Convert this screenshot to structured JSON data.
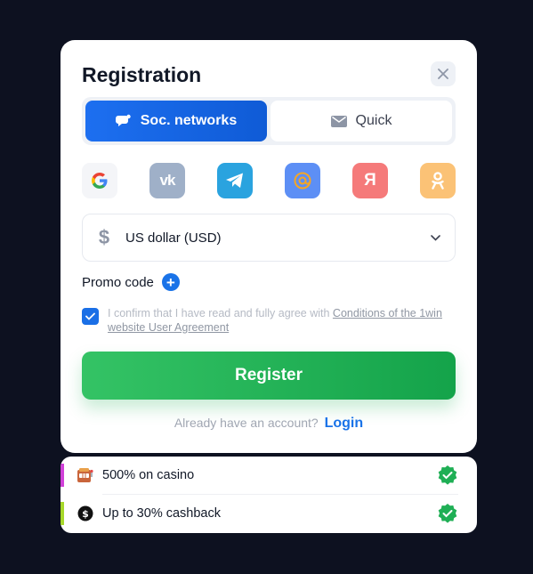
{
  "modal": {
    "title": "Registration",
    "close_icon": "close-icon"
  },
  "tabs": [
    {
      "label": "Soc. networks",
      "icon": "chat-bubble-icon",
      "active": true
    },
    {
      "label": "Quick",
      "icon": "envelope-icon",
      "active": false
    }
  ],
  "socials": [
    {
      "name": "google",
      "glyph": "G",
      "bg": "#f4f5f8"
    },
    {
      "name": "vk",
      "glyph": "vk",
      "bg": "#9fb0c8"
    },
    {
      "name": "telegram",
      "glyph": "",
      "bg": "#2aa3df"
    },
    {
      "name": "mail",
      "glyph": "@",
      "bg": "#5d8ff5"
    },
    {
      "name": "yandex",
      "glyph": "Я",
      "bg": "#f57a7a"
    },
    {
      "name": "odnoklassniki",
      "glyph": "ok",
      "bg": "#fbc276"
    }
  ],
  "currency": {
    "symbol": "$",
    "value": "US dollar (USD)"
  },
  "promo": {
    "label": "Promo code",
    "plus": "+"
  },
  "agreement": {
    "checked": true,
    "text": "I confirm that I have read and fully agree with ",
    "link": "Conditions of the 1win website User Agreement"
  },
  "register": {
    "label": "Register"
  },
  "account": {
    "prompt": "Already have an account?",
    "login": "Login"
  },
  "bonuses": [
    {
      "text": "500% on casino",
      "icon": "slot-machine-icon",
      "bar_color": "#d040d8"
    },
    {
      "text": "Up to 30% cashback",
      "icon": "cashback-icon",
      "bar_color": "#a7d82a"
    }
  ],
  "colors": {
    "accent_blue": "#1a73e8",
    "accent_green": "#1faf55",
    "background": "#0d1120"
  }
}
